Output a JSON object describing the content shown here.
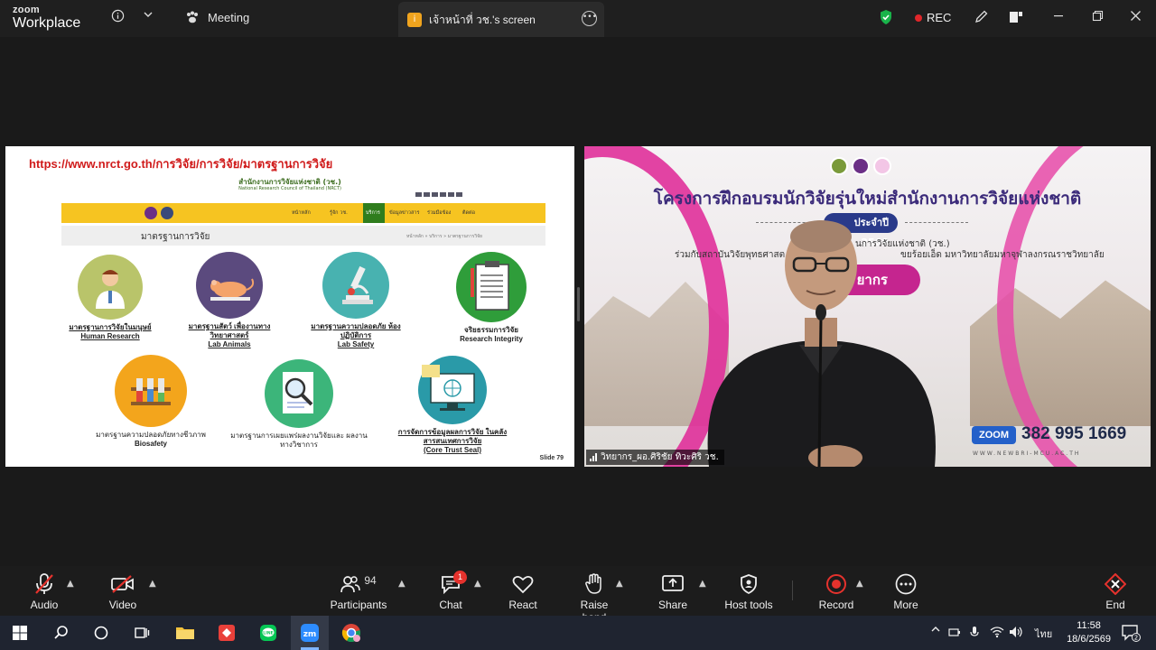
{
  "app": {
    "logo_line1": "zoom",
    "logo_line2": "Workplace",
    "meeting_label": "Meeting",
    "share_tab_badge": "i",
    "share_tab_name": "เจ้าหน้าที่ วช.'s screen",
    "rec_label": "REC"
  },
  "slide": {
    "url": "https://www.nrct.go.th/การวิจัย/การวิจัย/มาตรฐานการวิจัย",
    "site_title": "สำนักงานการวิจัยแห่งชาติ (วช.)",
    "site_subtitle": "National Research Council of Thailand (NRCT)",
    "nav_items": [
      "หน้าหลัก",
      "รู้จัก วช.",
      "บริการ",
      "ข้อมูลข่าวสาร",
      "ร่วมมือข้อง",
      "ติดต่อ"
    ],
    "section_title": "มาตรฐานการวิจัย",
    "breadcrumb": "หน้าหลัก » บริการ » มาตรฐานการวิจัย",
    "categories": [
      {
        "th": "มาตรฐานการวิจัยในมนุษย์",
        "en": "Human Research"
      },
      {
        "th": "มาตรฐานสัตว์ เพื่องานทางวิทยาศาสตร์",
        "en": "Lab Animals"
      },
      {
        "th": "มาตรฐานความปลอดภัย ห้องปฏิบัติการ",
        "en": "Lab Safety"
      },
      {
        "th": "จริยธรรมการวิจัย",
        "en": "Research Integrity"
      },
      {
        "th": "มาตรฐานความปลอดภัยทางชีวภาพ",
        "en": "Biosafety"
      },
      {
        "th": "มาตรฐานการเผยแพร่ผลงานวิจัยและ ผลงานทางวิชาการ",
        "en": ""
      },
      {
        "th": "การจัดการข้อมูลผลการวิจัย ในคลังสารสนเทศการวิจัย",
        "en": "(Core Trust Seal)"
      }
    ],
    "slide_number": "Slide 79"
  },
  "video": {
    "headline": "โครงการฝึกอบรมนักวิจัยรุ่นใหม่สำนักงานการวิจัยแห่งชาติ",
    "year_label": "ประจำปี 2569",
    "subline1": "นการวิจัยแห่งชาติ (วช.)",
    "subline2a": "ร่วมกับสถาบันวิจัยพุทธศาสต",
    "subline2b": "ขยร้อยเอ็ด มหาวิทยาลัยมหาจุฬาลงกรณราชวิทยาลัย",
    "speaker_pill": "ยากร",
    "zoom_label": "ZOOM",
    "zoom_id": "382 995 1669",
    "website": "WWW.NEWBRI-MCU.AC.TH",
    "participant_name": "วิทยากร_ผอ.ศิริชัย ทิวะศิริ วช."
  },
  "toolbar": {
    "audio": "Audio",
    "video": "Video",
    "participants": "Participants",
    "participant_count": "94",
    "chat": "Chat",
    "chat_badge": "1",
    "react": "React",
    "raise_hand": "Raise hand",
    "share": "Share",
    "host_tools": "Host tools",
    "record": "Record",
    "more": "More",
    "end": "End"
  },
  "taskbar": {
    "language": "ไทย",
    "time": "11:58",
    "date": "18/6/2569",
    "notification_count": "2",
    "zoom_app_label": "zm"
  },
  "colors": {
    "accent_pink": "#e0309a",
    "headline_purple": "#3b2a7a",
    "zoom_blue": "#2460c9",
    "record_red": "#e0262a",
    "url_red": "#d01b1b"
  }
}
